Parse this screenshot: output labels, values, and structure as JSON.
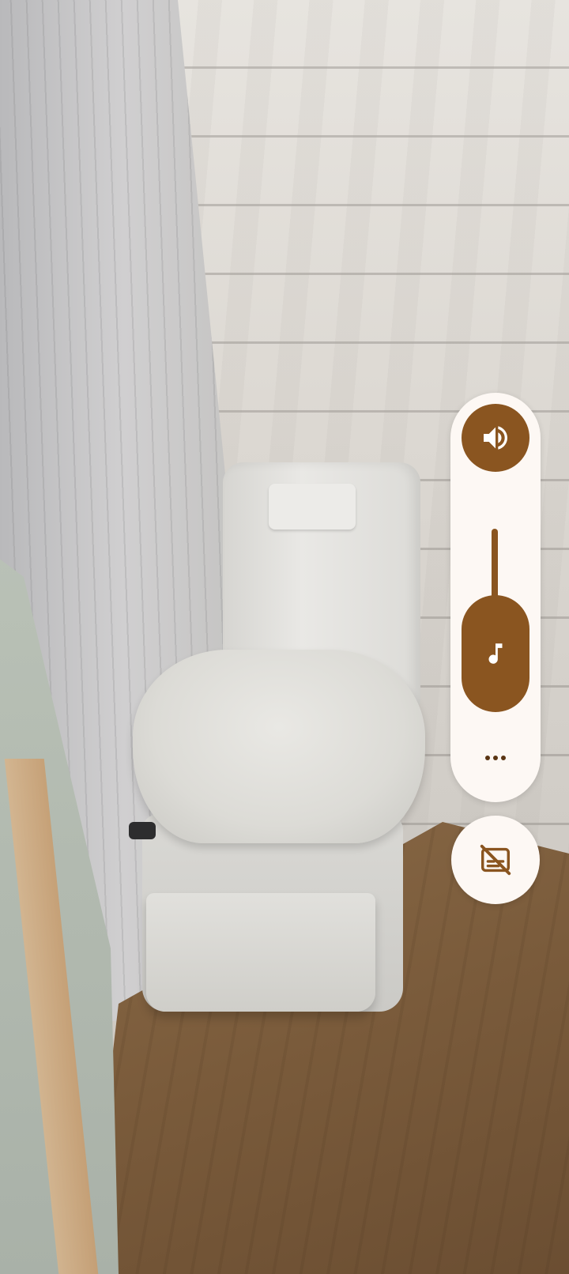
{
  "photo": {
    "scene": "photo-background"
  },
  "volume_panel": {
    "ringer_mode_icon": "speaker-icon",
    "stream_icon": "music-note-icon",
    "level_fraction": 0.55,
    "more_icon": "more-horizontal-icon",
    "accent_color": "#8a5520",
    "panel_color": "#fdf8f4"
  },
  "captions": {
    "icon": "captions-off-icon"
  }
}
